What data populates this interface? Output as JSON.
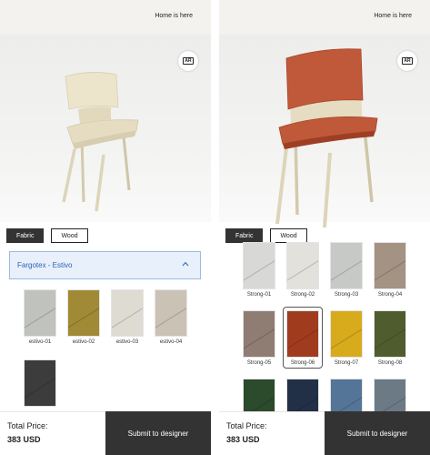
{
  "header": {
    "home_label": "Home is here"
  },
  "viewer": {
    "ar_label": "AR"
  },
  "tabs": [
    "Fabric",
    "Wood"
  ],
  "left": {
    "accordion_title": "Fargotex - Estivo",
    "swatches": [
      {
        "label": "estivo-01",
        "color": "#bfc2bd"
      },
      {
        "label": "estivo-02",
        "color": "#a08a36"
      },
      {
        "label": "estivo-03",
        "color": "#dedbd3"
      },
      {
        "label": "estivo-04",
        "color": "#cbc2b6"
      },
      {
        "label": "",
        "color": "#3c3c3c"
      }
    ]
  },
  "right": {
    "swatches": [
      {
        "label": "Strong-01",
        "color": "#d8d8d6"
      },
      {
        "label": "Strong-02",
        "color": "#e3e1dc"
      },
      {
        "label": "Strong-03",
        "color": "#c7c9c7"
      },
      {
        "label": "Strong-04",
        "color": "#a49282"
      },
      {
        "label": "Strong-05",
        "color": "#8f7c72"
      },
      {
        "label": "Strong-06",
        "color": "#a03c1d",
        "selected": true
      },
      {
        "label": "Strong-07",
        "color": "#d8ab1c"
      },
      {
        "label": "Strong-08",
        "color": "#4f5d2e"
      },
      {
        "label": "",
        "color": "#2c4a2c"
      },
      {
        "label": "",
        "color": "#223047"
      },
      {
        "label": "",
        "color": "#557598"
      },
      {
        "label": "",
        "color": "#6c7a86"
      }
    ]
  },
  "footer": {
    "total_label": "Total Price:",
    "total_value": "383 USD",
    "submit_label": "Submit to designer"
  },
  "colors": {
    "accent_blue": "#2d64b0",
    "dark": "#333333",
    "chair_wood": "#e6dec4",
    "seat_rust": "#c0583a"
  }
}
